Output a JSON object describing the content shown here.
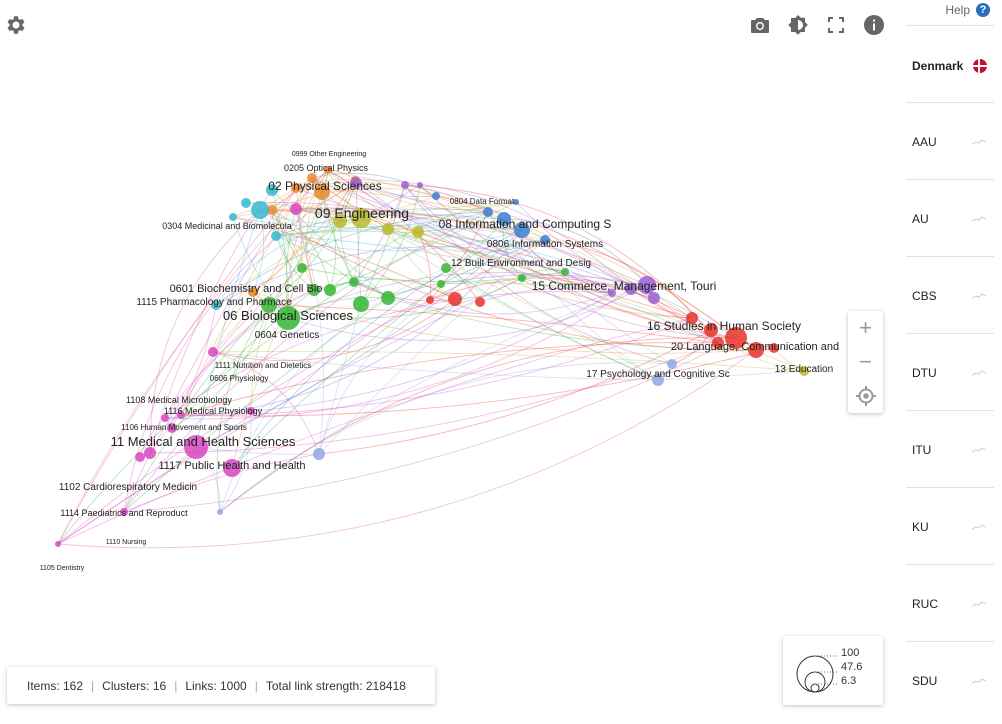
{
  "toolbar": {
    "settings_icon": "gear-icon",
    "screenshot_icon": "camera-icon",
    "theme_icon": "brightness-icon",
    "fullscreen_icon": "fullscreen-icon",
    "info_icon": "info-icon"
  },
  "zoom": {
    "in_label": "+",
    "out_label": "−",
    "locate_icon": "crosshair-icon"
  },
  "network": {
    "labels": [
      {
        "text": "0999 Other Engineering",
        "color": "#b8b82e"
      },
      {
        "text": "0205 Optical Physics",
        "color": "#e8872b"
      },
      {
        "text": "02 Physical Sciences",
        "color": "#e8872b"
      },
      {
        "text": "09 Engineering",
        "color": "#b8b82e"
      },
      {
        "text": "0804 Data Format",
        "color": "#3a7fd0"
      },
      {
        "text": "08 Information and Computing S",
        "color": "#3a7fd0"
      },
      {
        "text": "0806 Information Systems",
        "color": "#3a7fd0"
      },
      {
        "text": "0304 Medicinal and Biomolecula",
        "color": "#37b8cf"
      },
      {
        "text": "12 Built Environment and Desig",
        "color": "#35b535"
      },
      {
        "text": "0601 Biochemistry and Cell Bio",
        "color": "#35b535"
      },
      {
        "text": "1115 Pharmacology and Pharmace",
        "color": "#d946c1"
      },
      {
        "text": "15 Commerce, Management, Touri",
        "color": "#9b5fd0"
      },
      {
        "text": "06 Biological Sciences",
        "color": "#35b535"
      },
      {
        "text": "0604 Genetics",
        "color": "#35b535"
      },
      {
        "text": "16 Studies in Human Society",
        "color": "#e8322a"
      },
      {
        "text": "20 Language, Communication and",
        "color": "#e8322a"
      },
      {
        "text": "1111 Nutrition and Dietetics",
        "color": "#d946c1"
      },
      {
        "text": "0606 Physiology",
        "color": "#35b535"
      },
      {
        "text": "17 Psychology and Cognitive Sc",
        "color": "#8fa8e0"
      },
      {
        "text": "13 Education",
        "color": "#c8c83a"
      },
      {
        "text": "1108 Medical Microbiology",
        "color": "#d946c1"
      },
      {
        "text": "1116 Medical Physiology",
        "color": "#d946c1"
      },
      {
        "text": "1106 Human Movement and Sports",
        "color": "#d946c1"
      },
      {
        "text": "11 Medical and Health Sciences",
        "color": "#d946c1"
      },
      {
        "text": "1117 Public Health and Health",
        "color": "#d946c1"
      },
      {
        "text": "1102 Cardiorespiratory Medicin",
        "color": "#d946c1"
      },
      {
        "text": "1114 Paediatrics and Reproduct",
        "color": "#d946c1"
      },
      {
        "text": "1110 Nursing",
        "color": "#d946c1"
      },
      {
        "text": "1105 Dentistry",
        "color": "#d946c1"
      }
    ]
  },
  "stats": {
    "items": "Items: 162",
    "clusters": "Clusters: 16",
    "links": "Links: 1000",
    "strength": "Total link strength: 218418"
  },
  "size_legend": {
    "v1": "100",
    "v2": "47.6",
    "v3": "6.3"
  },
  "sidebar": {
    "help_label": "Help",
    "help_icon": "question-icon",
    "country": "Denmark",
    "universities": [
      "AAU",
      "AU",
      "CBS",
      "DTU",
      "ITU",
      "KU",
      "RUC",
      "SDU"
    ]
  },
  "colors": {
    "engineering": "#b8b82e",
    "physical": "#e8872b",
    "information": "#3a7fd0",
    "biomedical": "#37b8cf",
    "biological": "#35b535",
    "commerce": "#9b5fd0",
    "society": "#e8322a",
    "medical": "#d946c1",
    "psychology": "#8fa8e0",
    "accent": "#2a6ebb"
  }
}
